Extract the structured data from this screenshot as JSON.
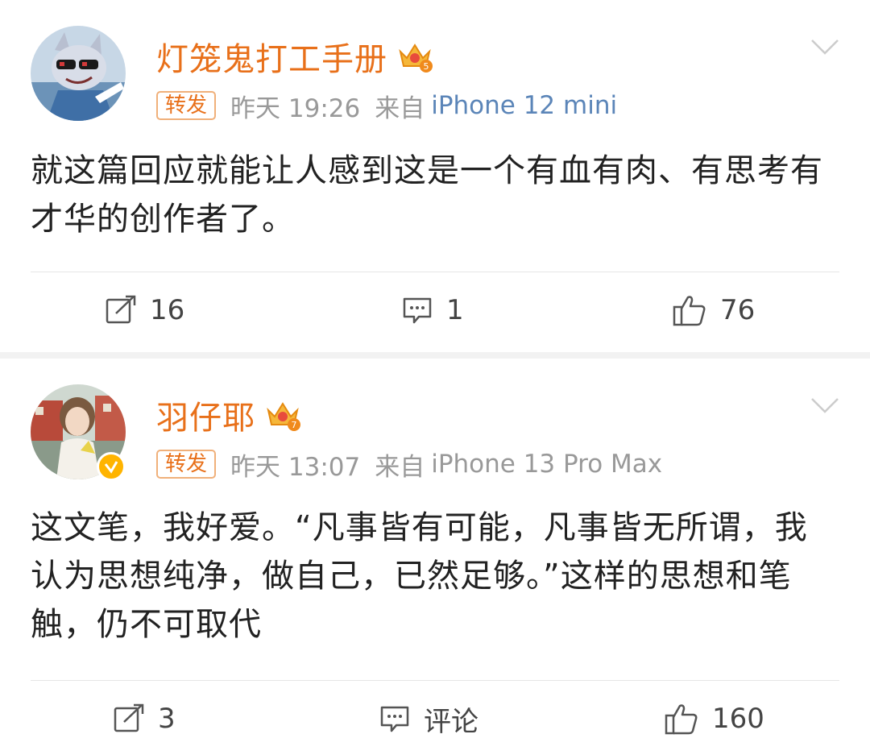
{
  "posts": [
    {
      "username": "灯笼鬼打工手册",
      "repost_tag": "转发",
      "time": "昨天 19:26",
      "source_prefix": "来自",
      "device": "iPhone 12 mini",
      "content": "就这篇回应就能让人感到这是一个有血有肉、有思考有才华的创作者了。",
      "reposts": "16",
      "comments": "1",
      "likes": "76",
      "vip_level": "5"
    },
    {
      "username": "羽仔耶",
      "repost_tag": "转发",
      "time": "昨天 13:07",
      "source_prefix": "来自",
      "device": "iPhone 13 Pro Max",
      "content": "这文笔，我好爱。“凡事皆有可能，凡事皆无所谓，我认为思想纯净，做自己，已然足够。”这样的思想和笔触，仍不可取代",
      "reposts": "3",
      "comments": "评论",
      "likes": "160",
      "vip_level": "7"
    }
  ],
  "colors": {
    "username": "#e8701a",
    "meta": "#999999",
    "device_link": "#5b85b8",
    "verified": "#ffb400",
    "separator": "#f2f2f2"
  },
  "icons": {
    "repost": "repost-icon",
    "comment": "comment-icon",
    "like": "like-icon",
    "vip": "vip-crown-icon",
    "more": "chevron-down-icon",
    "verified": "verified-badge-icon"
  }
}
